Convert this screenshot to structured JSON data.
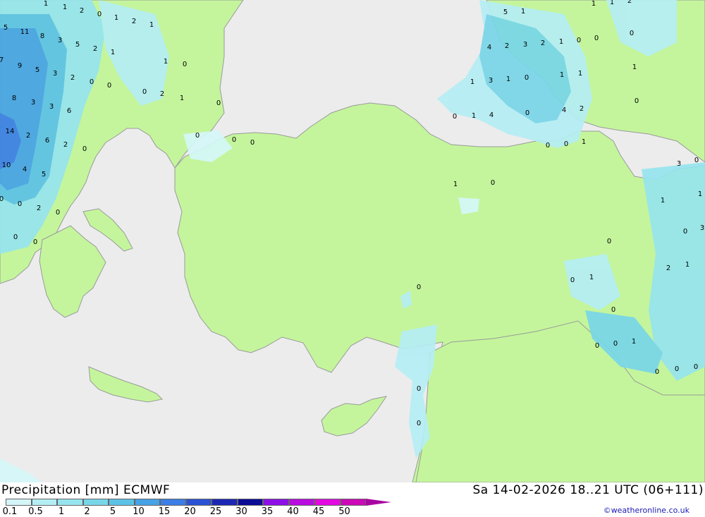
{
  "header": {
    "title": "Precipitation [mm] ECMWF",
    "datetime": "Sa 14-02-2026 18..21 UTC (06+111)",
    "credit": "©weatheronline.co.uk"
  },
  "legend": {
    "labels": [
      "0.1",
      "0.5",
      "1",
      "2",
      "5",
      "10",
      "15",
      "20",
      "25",
      "30",
      "35",
      "40",
      "45",
      "50"
    ],
    "colors": [
      "#d4f6f8",
      "#b4eef4",
      "#96e4ee",
      "#78d6e8",
      "#5cc2e6",
      "#46a2e6",
      "#3a7ee6",
      "#2a52d4",
      "#1c28b4",
      "#0c0c96",
      "#8c10e6",
      "#b80ce0",
      "#e20ae0",
      "#cc08b8",
      "#a806a0"
    ]
  },
  "colors": {
    "land": "#c4f59c",
    "sea": "#ececec",
    "border": "#9a9a9a"
  },
  "map_labels": [
    "1",
    "1",
    "2",
    "0",
    "1",
    "2",
    "1",
    "5",
    "11",
    "8",
    "3",
    "5",
    "2",
    "1",
    "7",
    "9",
    "5",
    "3",
    "2",
    "0",
    "0",
    "1",
    "0",
    "8",
    "3",
    "3",
    "6",
    "1",
    "0",
    "14",
    "2",
    "6",
    "2",
    "0",
    "10",
    "4",
    "5",
    "0",
    "0",
    "2",
    "0",
    "0",
    "0",
    "0",
    "0",
    "0",
    "5",
    "1",
    "4",
    "2",
    "3",
    "2",
    "1",
    "0",
    "0",
    "1",
    "3",
    "1",
    "0",
    "1",
    "1",
    "0",
    "1",
    "4",
    "0",
    "4",
    "2",
    "0",
    "0",
    "1",
    "1",
    "0",
    "1",
    "3",
    "0",
    "1",
    "1",
    "0",
    "3",
    "0",
    "2",
    "1",
    "0",
    "1",
    "0",
    "0",
    "0",
    "1",
    "0",
    "0",
    "0",
    "1",
    "0",
    "0",
    "0",
    "0",
    "0",
    "1",
    "2",
    "2",
    "0"
  ]
}
